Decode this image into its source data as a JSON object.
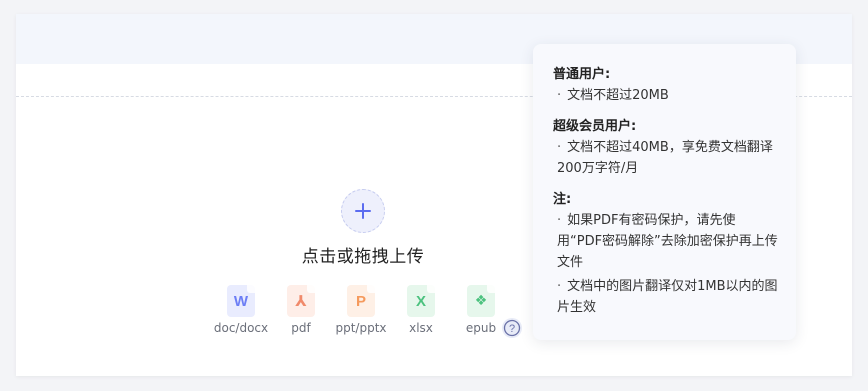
{
  "upload": {
    "label": "点击或拖拽上传"
  },
  "formats": [
    {
      "label": "doc/docx",
      "icon": "word-doc-icon",
      "glyph": "W",
      "color": "#6c7ef5",
      "bg": "#e9ecfe"
    },
    {
      "label": "pdf",
      "icon": "pdf-icon",
      "glyph": "⅄",
      "color": "#f08a6b",
      "bg": "#feeee8"
    },
    {
      "label": "ppt/pptx",
      "icon": "ppt-icon",
      "glyph": "P",
      "color": "#f59a5d",
      "bg": "#fef0e6"
    },
    {
      "label": "xlsx",
      "icon": "excel-icon",
      "glyph": "X",
      "color": "#4cc27f",
      "bg": "#e6f7ec"
    },
    {
      "label": "epub",
      "icon": "epub-icon",
      "glyph": "❖",
      "color": "#4cc27f",
      "bg": "#e6f7ec"
    }
  ],
  "help": {
    "icon": "question-circle-icon",
    "glyph": "?"
  },
  "tooltip": {
    "sections": [
      {
        "title": "普通用户:",
        "bullets": [
          "文档不超过20MB"
        ]
      },
      {
        "title": "超级会员用户:",
        "bullets": [
          "文档不超过40MB，享免费文档翻译200万字符/月"
        ]
      },
      {
        "title": "注:",
        "bullets": [
          "如果PDF有密码保护，请先使用“PDF密码解除”去除加密保护再上传文件",
          "文档中的图片翻译仅对1MB以内的图片生效"
        ]
      }
    ]
  }
}
